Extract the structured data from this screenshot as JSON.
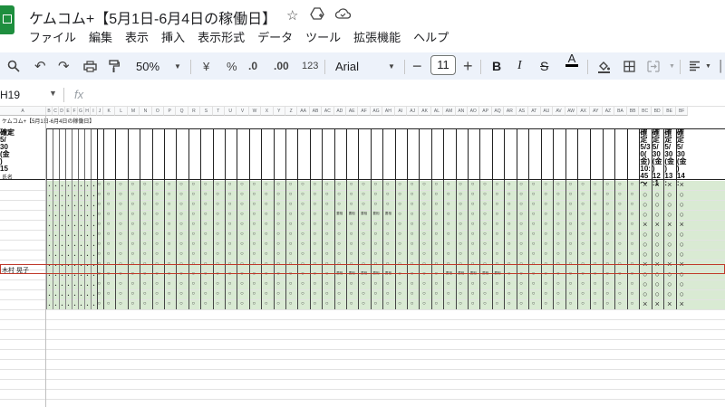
{
  "app": {
    "title": "ケムコム+【5月1日-6月4日の稼働日】",
    "title_icons": [
      "star-icon",
      "move-to-drive-icon",
      "cloud-status-icon"
    ]
  },
  "menu": [
    "ファイル",
    "編集",
    "表示",
    "挿入",
    "表示形式",
    "データ",
    "ツール",
    "拡張機能",
    "ヘルプ"
  ],
  "toolbar": {
    "zoom": "50%",
    "currency": "¥",
    "percent": "%",
    "decimal_decrease": ".0",
    "decimal_increase": ".00",
    "number_format": "123",
    "font": "Arial",
    "font_size": "11",
    "bold": "B",
    "italic": "I"
  },
  "formula_bar": {
    "name_box": "H19",
    "fx": "fx"
  },
  "sheet": {
    "a1_title": "ケムコム+【5月1日-6月4日の稼働日】",
    "row_kakutei": "確定",
    "row_name_label": "氏名",
    "highlight_name": "木村 晃子",
    "column_letters": [
      "A",
      "B",
      "C",
      "D",
      "E",
      "F",
      "G",
      "H",
      "I",
      "J",
      "K",
      "L",
      "M",
      "N",
      "O",
      "P",
      "Q",
      "R",
      "S",
      "T",
      "U",
      "V",
      "W",
      "X",
      "Y",
      "Z",
      "AA",
      "AB",
      "AC",
      "AD",
      "AE",
      "AF",
      "AG",
      "AH",
      "AI",
      "AJ",
      "AK",
      "AL",
      "AM",
      "AN",
      "AO",
      "AP",
      "AQ",
      "AR",
      "AS",
      "AT",
      "AU",
      "AV",
      "AW",
      "AX",
      "AY",
      "AZ",
      "BA",
      "BB",
      "BC",
      "BD",
      "BE",
      "BF"
    ],
    "right_header_lines": [
      [
        "確定",
        "5/3",
        "0(",
        "金)",
        "10:",
        "45",
        "〜"
      ],
      [
        "確定",
        "5/",
        "30",
        "(金",
        ")",
        "12",
        ":1"
      ],
      [
        "確定",
        "5/",
        "30",
        "(金",
        ")",
        "13",
        ":"
      ],
      [
        "確定",
        "5/",
        "30",
        "(金",
        ")",
        "14",
        ":"
      ],
      [
        "確定",
        "5/",
        "30",
        "(金",
        ")",
        "15",
        ""
      ]
    ],
    "marks": {
      "circle": "○",
      "cross": "×",
      "dot": "・",
      "amb": "要相"
    }
  }
}
